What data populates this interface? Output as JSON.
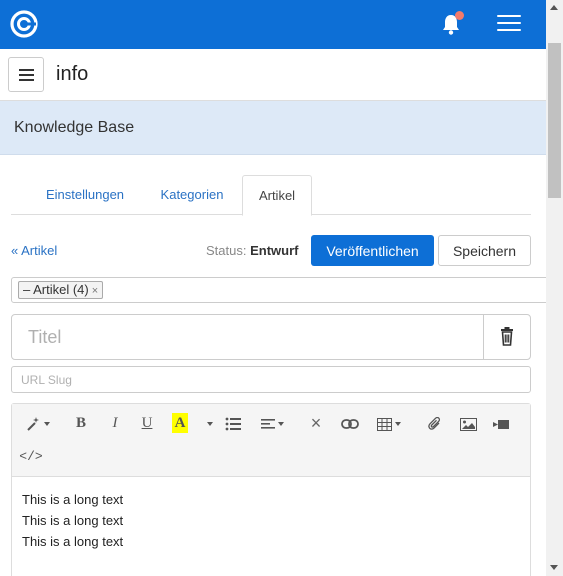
{
  "topbar": {
    "logo_icon": "spiral-logo-icon",
    "bell_icon": "bell-icon",
    "menu_icon": "hamburger-icon",
    "has_notification": true,
    "color": "#0d6fd6"
  },
  "header": {
    "title": "info"
  },
  "kb": {
    "title": "Knowledge Base"
  },
  "tabs": [
    {
      "label": "Einstellungen",
      "active": false
    },
    {
      "label": "Kategorien",
      "active": false
    },
    {
      "label": "Artikel",
      "active": true
    }
  ],
  "actions": {
    "back_label": "« Artikel",
    "status_label": "Status:",
    "status_value": "Entwurf",
    "publish_label": "Veröffentlichen",
    "save_label": "Speichern"
  },
  "category_tag": {
    "label": "– Artikel (4)",
    "remove": "×"
  },
  "form": {
    "title_placeholder": "Titel",
    "title_value": "",
    "slug_placeholder": "URL Slug",
    "slug_value": ""
  },
  "toolbar": {
    "buttons": [
      "magic-wand-icon",
      "bold-icon",
      "italic-icon",
      "underline-icon",
      "highlight-icon",
      "list-icon",
      "align-icon",
      "clear-format-icon",
      "link-icon",
      "table-icon",
      "attachment-icon",
      "image-icon",
      "video-icon",
      "code-icon"
    ],
    "bold": "B",
    "italic": "I",
    "underline": "U",
    "highlight": "A",
    "clear": "×",
    "code": "</>"
  },
  "content": {
    "lines": [
      "This is a long text",
      "This is a long text",
      "This is a long text"
    ]
  }
}
